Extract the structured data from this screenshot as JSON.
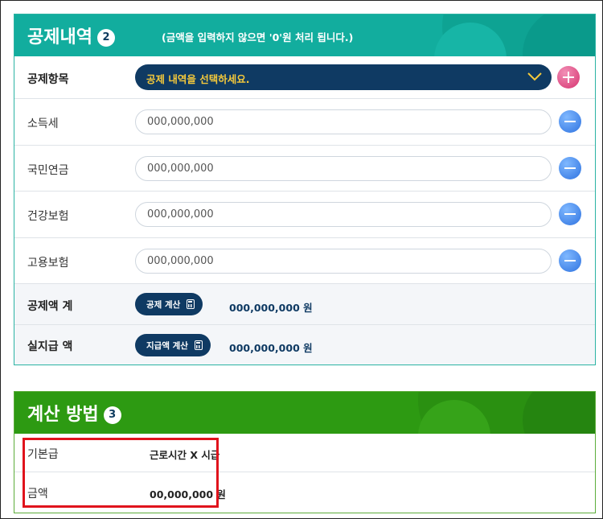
{
  "deduction_section": {
    "title": "공제내역",
    "step": "2",
    "note": "(금액을 입력하지 않으면 '0'원 처리 됩니다.)",
    "item_label": "공제항목",
    "select_text": "공제 내역을 선택하세요.",
    "rows": [
      {
        "label": "소득세",
        "placeholder": "000,000,000"
      },
      {
        "label": "국민연금",
        "placeholder": "000,000,000"
      },
      {
        "label": "건강보험",
        "placeholder": "000,000,000"
      },
      {
        "label": "고용보험",
        "placeholder": "000,000,000"
      }
    ],
    "total": {
      "label": "공제액 계",
      "button": "공제 계산",
      "amount": "000,000,000 원"
    },
    "net": {
      "label": "실지급 액",
      "button": "지급액 계산",
      "amount": "000,000,000 원"
    }
  },
  "method_section": {
    "title": "계산 방법",
    "step": "3",
    "rows": [
      {
        "label": "기본급",
        "value": "근로시간 X 시급"
      },
      {
        "label": "금액",
        "value": "00,000,000 원"
      }
    ]
  },
  "colors": {
    "teal_header": "#12ad9e",
    "green_header": "#2d9a12",
    "navy": "#0f3a63",
    "select_text": "#f5c93b",
    "highlight": "#e0131c"
  },
  "icons": [
    "chevron-down-icon",
    "plus-icon",
    "minus-icon",
    "calculator-icon"
  ]
}
